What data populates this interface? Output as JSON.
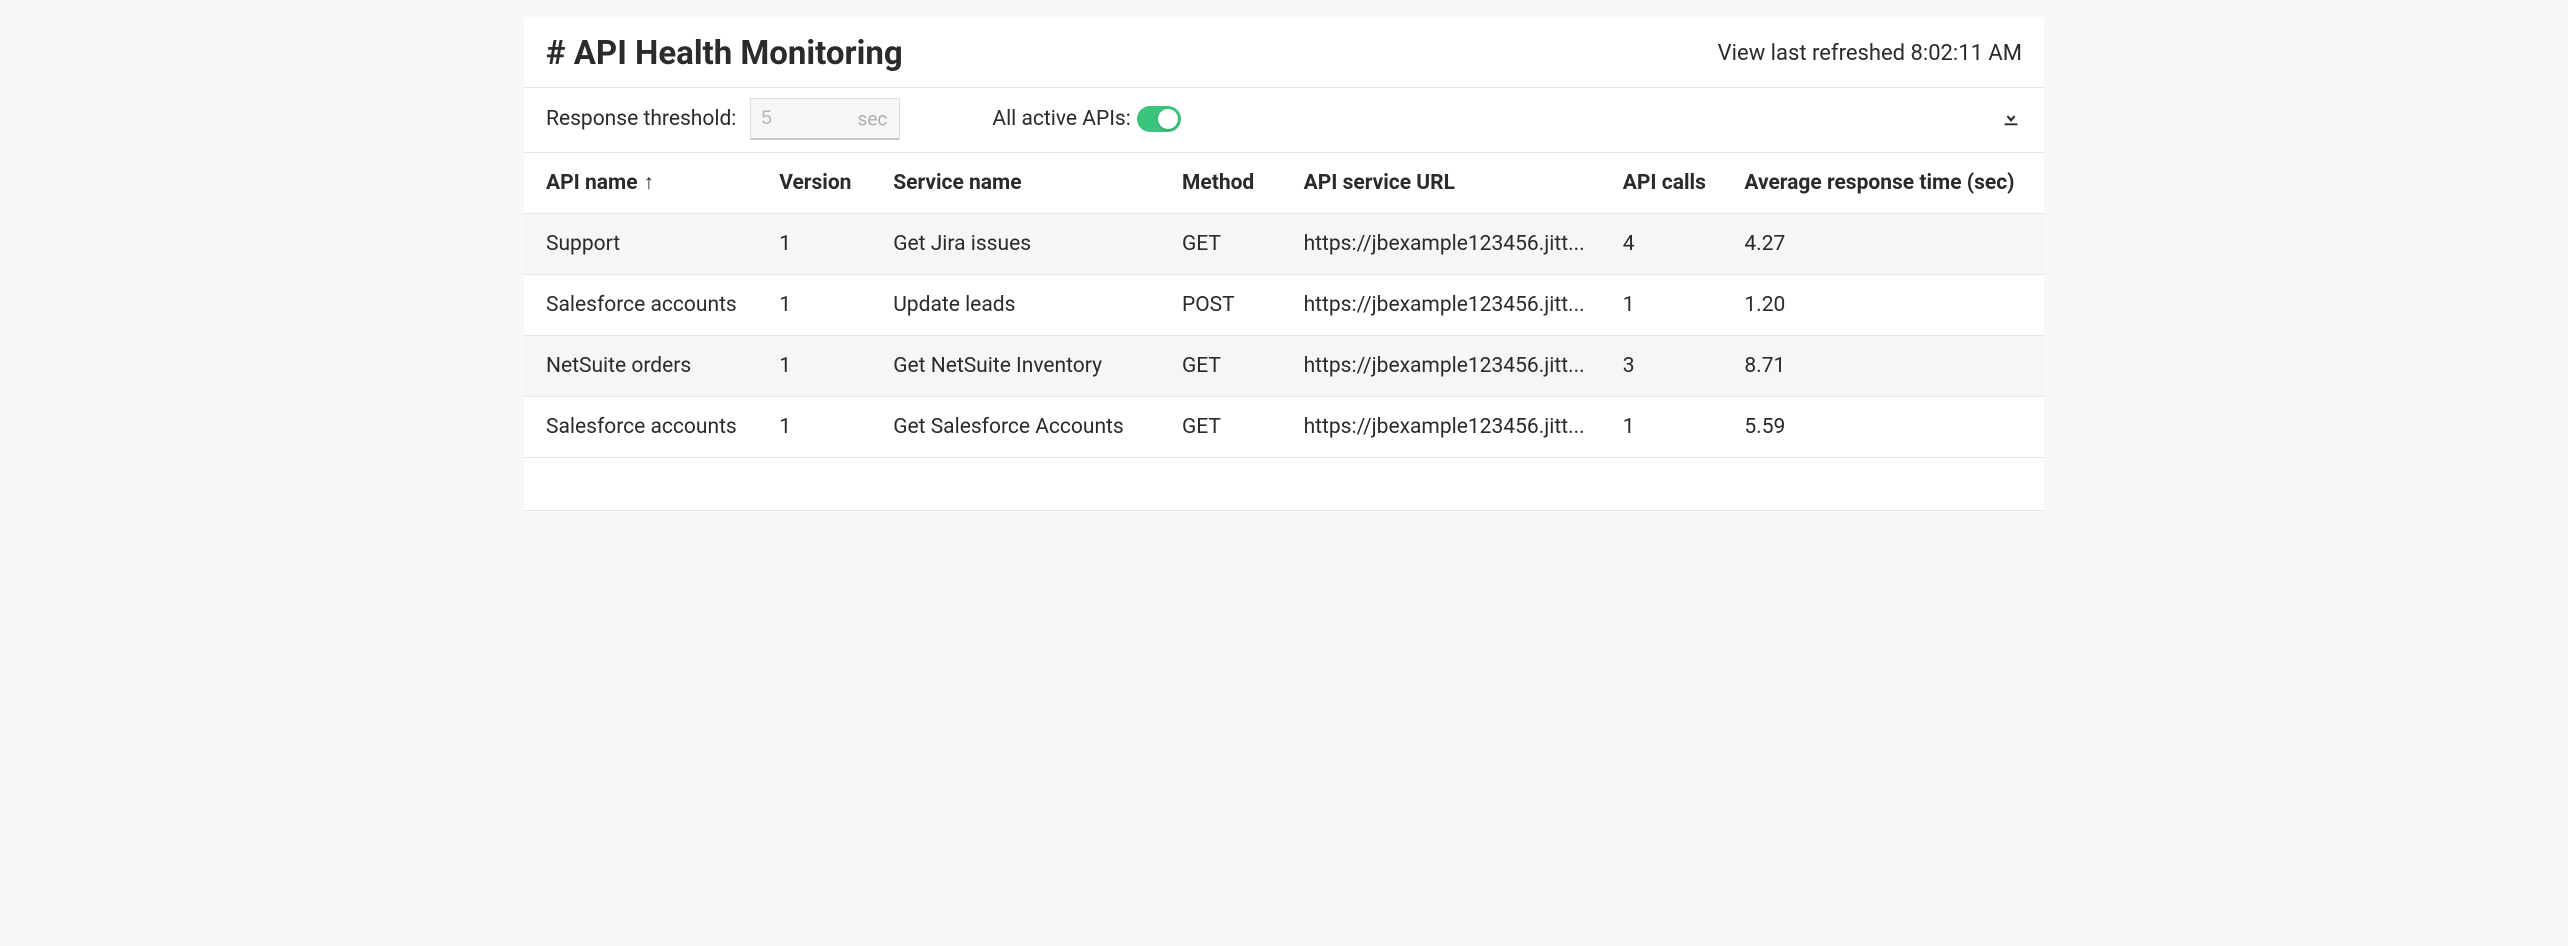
{
  "header": {
    "title": "# API Health Monitoring",
    "refreshed_prefix": "View last refreshed ",
    "refreshed_time": "8:02:11 AM"
  },
  "controls": {
    "threshold_label": "Response threshold:",
    "threshold_placeholder": "5",
    "threshold_unit": "sec",
    "active_apis_label": "All active APIs:",
    "active_apis_on": true
  },
  "table": {
    "columns": {
      "api_name": "API name",
      "version": "Version",
      "service_name": "Service name",
      "method": "Method",
      "url": "API service URL",
      "api_calls": "API calls",
      "avg_response": "Average response time (sec)"
    },
    "sort_arrow": "↑",
    "rows": [
      {
        "api_name": "Support",
        "version": "1",
        "service_name": "Get Jira issues",
        "method": "GET",
        "url": "https://jbexample123456.jitt...",
        "api_calls": "4",
        "avg_response": "4.27"
      },
      {
        "api_name": "Salesforce accounts",
        "version": "1",
        "service_name": "Update leads",
        "method": "POST",
        "url": "https://jbexample123456.jitt...",
        "api_calls": "1",
        "avg_response": "1.20"
      },
      {
        "api_name": "NetSuite orders",
        "version": "1",
        "service_name": "Get NetSuite Inventory",
        "method": "GET",
        "url": "https://jbexample123456.jitt...",
        "api_calls": "3",
        "avg_response": "8.71"
      },
      {
        "api_name": "Salesforce accounts",
        "version": "1",
        "service_name": "Get Salesforce Accounts",
        "method": "GET",
        "url": "https://jbexample123456.jitt...",
        "api_calls": "1",
        "avg_response": "5.59"
      }
    ]
  }
}
